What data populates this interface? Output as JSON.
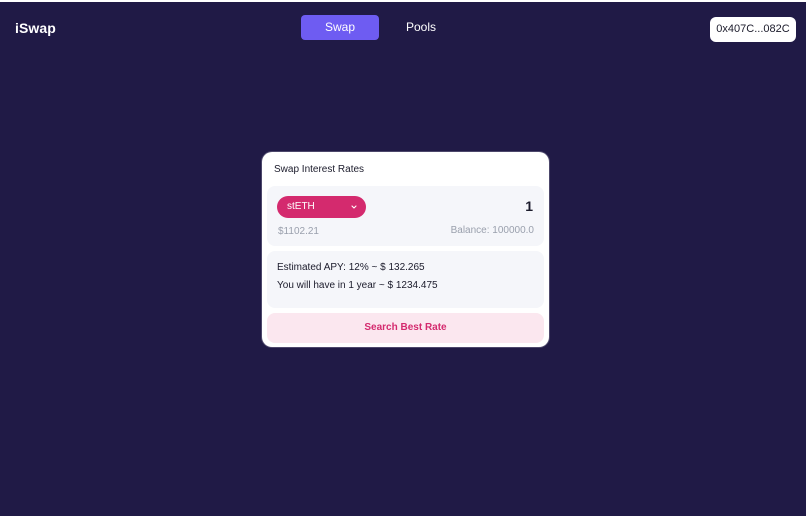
{
  "header": {
    "logo": "iSwap",
    "tabs": [
      {
        "label": "Swap",
        "active": true
      },
      {
        "label": "Pools",
        "active": false
      }
    ],
    "wallet_address": "0x407C...082C"
  },
  "swap_card": {
    "title": "Swap Interest Rates",
    "token": {
      "selected": "stETH",
      "icon": "chevron-down-icon",
      "amount": "1",
      "usd_value": "$1102.21",
      "balance": "Balance: 100000.0"
    },
    "estimate": {
      "apy_line": "Estimated APY: 12% ~ $ 132.265",
      "year_line": "You will have in 1 year ~ $ 1234.475"
    },
    "search_button": "Search Best Rate"
  },
  "colors": {
    "background": "#201a46",
    "active_tab": "#6e5cf2",
    "accent": "#d42a6e",
    "button_bg": "#fbe7ef"
  }
}
